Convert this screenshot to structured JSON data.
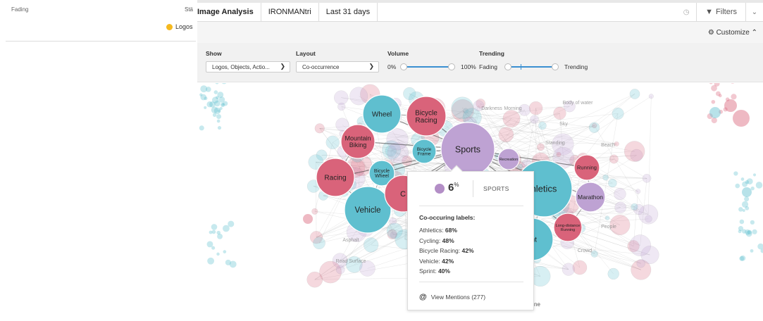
{
  "background_window": {
    "fading_label": "Fading",
    "sta_label": "Stä",
    "logos_label": "Logos"
  },
  "toolbar": {
    "tabs": [
      "Image Analysis",
      "IRONMANtri",
      "Last 31 days"
    ],
    "filters_label": "Filters",
    "customize_label": "Customize"
  },
  "controls": {
    "show": {
      "label": "Show",
      "value": "Logos, Objects, Actio..."
    },
    "layout": {
      "label": "Layout",
      "value": "Co-occurrence"
    },
    "volume": {
      "label": "Volume",
      "min_label": "0%",
      "max_label": "100%",
      "range": [
        0,
        1
      ]
    },
    "trending": {
      "label": "Trending",
      "min_label": "Fading",
      "max_label": "Trending",
      "marker": 0.3
    }
  },
  "graph": {
    "colors": {
      "teal": "#5fbfcf",
      "pink": "#d9637a",
      "purple": "#bea2d3",
      "blue_track": "#3a8fd1"
    },
    "labeled_nodes": [
      {
        "label": "Sports",
        "color": "purple"
      },
      {
        "label": "Bicycle Racing",
        "color": "pink"
      },
      {
        "label": "Wheel",
        "color": "teal"
      },
      {
        "label": "Mountain Biking",
        "color": "pink"
      },
      {
        "label": "Bicycle Frame",
        "color": "teal"
      },
      {
        "label": "Racing",
        "color": "pink"
      },
      {
        "label": "Bicycle Wheel",
        "color": "teal"
      },
      {
        "label": "Vehicle",
        "color": "teal"
      },
      {
        "label": "hletics",
        "color": "teal"
      },
      {
        "label": "Running",
        "color": "pink"
      },
      {
        "label": "Marathon",
        "color": "purple"
      },
      {
        "label": "Recreation",
        "color": "purple"
      },
      {
        "label": "Long-distance Running",
        "color": "pink"
      },
      {
        "label": "rint",
        "color": "teal"
      },
      {
        "label": "C",
        "color": "pink"
      }
    ],
    "faint_labels": [
      "Darkness",
      "Morning",
      "Body of water",
      "Sky",
      "Beach",
      "Standing",
      "Asphalt",
      "Road Surface",
      "People",
      "Crowd"
    ]
  },
  "popup": {
    "percent": "6",
    "percent_unit": "%",
    "name": "SPORTS",
    "co_title": "Co-occuring labels:",
    "co_items": [
      {
        "label": "Athletics",
        "value": "68%"
      },
      {
        "label": "Cycling",
        "value": "48%"
      },
      {
        "label": "Bicycle Racing",
        "value": "42%"
      },
      {
        "label": "Vehicle",
        "value": "42%"
      },
      {
        "label": "Sprint",
        "value": "40%"
      }
    ],
    "mentions_label": "View Mentions (277)"
  },
  "partial_labels": {
    "ne": "ne"
  }
}
